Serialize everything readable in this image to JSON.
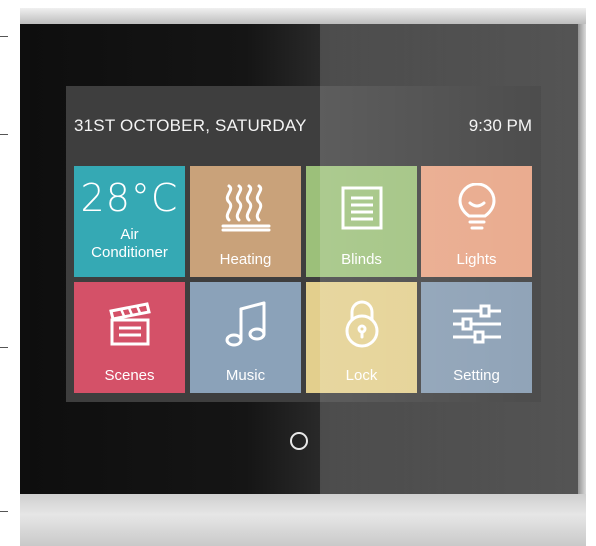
{
  "header": {
    "date": "31ST OCTOBER, SATURDAY",
    "time": "9:30 PM"
  },
  "tiles": [
    {
      "id": "air-conditioner",
      "temperature": "28°C",
      "label_line1": "Air",
      "label_line2": "Conditioner",
      "color": "#35a9b4",
      "icon": "temperature"
    },
    {
      "id": "heating",
      "label": "Heating",
      "color": "#c9a27a",
      "icon": "heating-icon"
    },
    {
      "id": "blinds",
      "label": "Blinds",
      "color": "#9cc07a",
      "icon": "blinds-icon"
    },
    {
      "id": "lights",
      "label": "Lights",
      "color": "#e8a586",
      "icon": "light-bulb-icon"
    },
    {
      "id": "scenes",
      "label": "Scenes",
      "color": "#d45168",
      "icon": "clapperboard-icon"
    },
    {
      "id": "music",
      "label": "Music",
      "color": "#8ba2b9",
      "icon": "music-note-icon"
    },
    {
      "id": "lock",
      "label": "Lock",
      "color": "#e3cf8d",
      "icon": "padlock-icon"
    },
    {
      "id": "setting",
      "label": "Setting",
      "color": "#879cb2",
      "icon": "sliders-icon"
    }
  ]
}
